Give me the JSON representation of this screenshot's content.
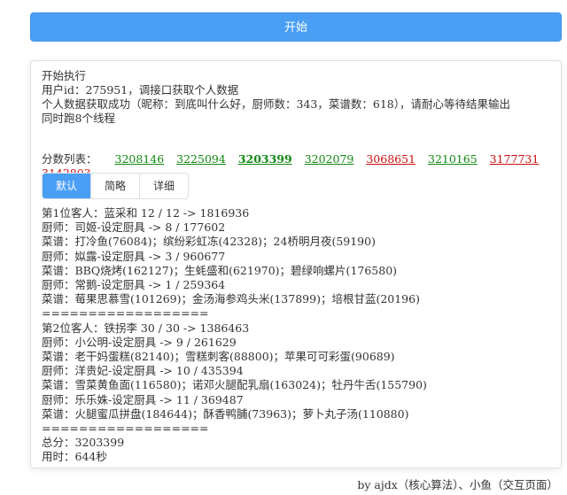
{
  "start_button": {
    "label": "开始"
  },
  "log": {
    "lines": [
      "开始执行",
      "用户id：275951，调接口获取个人数据",
      "个人数据获取成功（昵称：到底叫什么好，厨师数：343，菜谱数：618），请耐心等待结果输出",
      "同时跑8个线程"
    ]
  },
  "scores": {
    "label": "分数列表：",
    "items": [
      {
        "value": "3208146",
        "color": "#118811"
      },
      {
        "value": "3225094",
        "color": "#118811"
      },
      {
        "value": "3203399",
        "color": "#118811"
      },
      {
        "value": "3202079",
        "color": "#118811"
      },
      {
        "value": "3068651",
        "color": "#cc1111"
      },
      {
        "value": "3210165",
        "color": "#118811"
      },
      {
        "value": "3177731",
        "color": "#cc1111"
      },
      {
        "value": "3142803",
        "color": "#cc1111"
      }
    ]
  },
  "tabs": [
    {
      "label": "默认",
      "active": true
    },
    {
      "label": "简略",
      "active": false
    },
    {
      "label": "详细",
      "active": false
    }
  ],
  "results": {
    "lines": [
      "第1位客人：蓝采和 12 / 12 -> 1816936",
      "厨师：司姬-设定厨具 -> 8 / 177602",
      "菜谱：打冷鱼(76084)；缤纷彩虹冻(42328)；24桥明月夜(59190)",
      "厨师：姒露-设定厨具 -> 3 / 960677",
      "菜谱：BBQ烧烤(162127)；生蚝盛和(621970)；碧绿响螺片(176580)",
      "厨师：常鹅-设定厨具 -> 1 / 259364",
      "菜谱：莓果思慕雪(101269)；金汤海参鸡头米(137899)；培根甘蓝(20196)",
      "==================",
      "第2位客人：铁拐李 30 / 30 -> 1386463",
      "厨师：小公明-设定厨具 -> 9 / 261629",
      "菜谱：老干妈蛋糕(82140)；雪糕刺客(88800)；苹果可可彩蛋(90689)",
      "厨师：洋贵妃-设定厨具 -> 10 / 435394",
      "菜谱：雪菜黄鱼面(116580)；诺邓火腿配乳扇(163024)；牡丹牛舌(155790)",
      "厨师：乐乐姝-设定厨具 -> 11 / 369487",
      "菜谱：火腿蜜瓜拼盘(184644)；酥香鸭脯(73963)；萝卜丸子汤(110880)",
      "==================",
      "总分：3203399",
      "用时：644秒"
    ]
  },
  "footer": {
    "credit": "by ajdx（核心算法）、小鱼（交互页面）"
  }
}
